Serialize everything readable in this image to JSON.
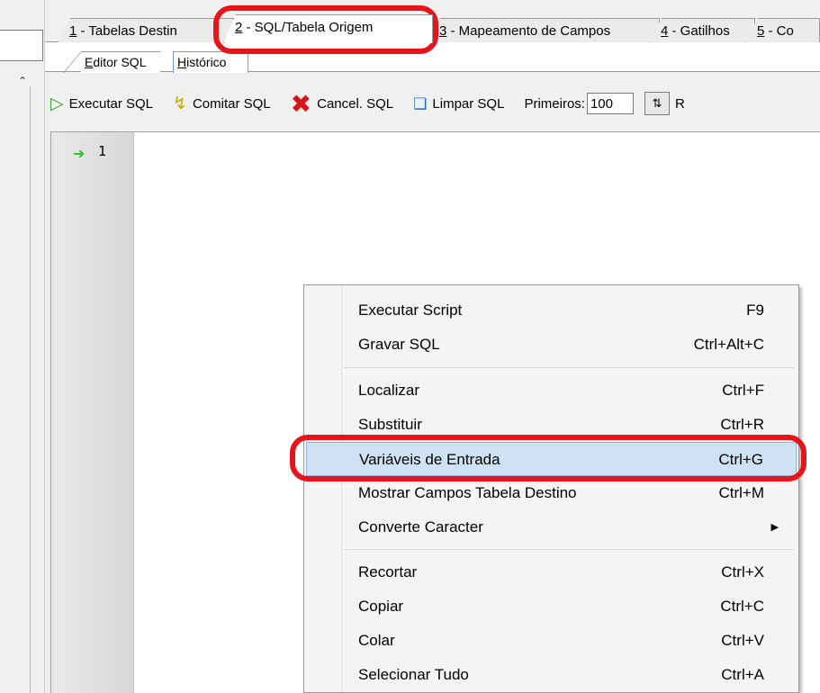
{
  "tabs": [
    {
      "prefix": "1",
      "label": " - Tabelas Destin"
    },
    {
      "prefix": "2",
      "label": " - SQL/Tabela Origem"
    },
    {
      "prefix": "3",
      "label": " - Mapeamento de Campos"
    },
    {
      "prefix": "4",
      "label": " - Gatilhos"
    },
    {
      "prefix": "5",
      "label": " - Co"
    }
  ],
  "subtabs": [
    {
      "prefix": "E",
      "label": "ditor SQL"
    },
    {
      "prefix": "H",
      "label": "istórico"
    }
  ],
  "toolbar": {
    "execute_label": "Executar SQL",
    "commit_label": "Comitar SQL",
    "cancel_label": "Cancel. SQL",
    "clear_label": "Limpar SQL",
    "first_label": "Primeiros:",
    "first_value": "100",
    "trailing_label": "R"
  },
  "editor": {
    "line_number": "1"
  },
  "menu": {
    "items": [
      {
        "label": "Executar Script",
        "shortcut": "F9"
      },
      {
        "label": "Gravar SQL",
        "shortcut": "Ctrl+Alt+C"
      },
      {
        "label": "Localizar",
        "shortcut": "Ctrl+F"
      },
      {
        "label": "Substituir",
        "shortcut": "Ctrl+R"
      },
      {
        "label": "Variáveis de Entrada",
        "shortcut": "Ctrl+G"
      },
      {
        "label": "Mostrar Campos Tabela Destino",
        "shortcut": "Ctrl+M"
      },
      {
        "label": "Converte Caracter",
        "shortcut": ""
      },
      {
        "label": "Recortar",
        "shortcut": "Ctrl+X"
      },
      {
        "label": "Copiar",
        "shortcut": "Ctrl+C"
      },
      {
        "label": "Colar",
        "shortcut": "Ctrl+V"
      },
      {
        "label": "Selecionar Tudo",
        "shortcut": "Ctrl+A"
      }
    ]
  },
  "icons": {
    "execute": "play-icon",
    "commit": "lightning-icon",
    "cancel": "red-x-icon",
    "clear": "clear-document-icon",
    "spin": "sort-spin-icon",
    "gutter": "current-line-arrow-icon",
    "submenu": "submenu-arrow-icon"
  },
  "colors": {
    "highlight": "#e8141b",
    "menu_hover": "#cfe2f3"
  }
}
